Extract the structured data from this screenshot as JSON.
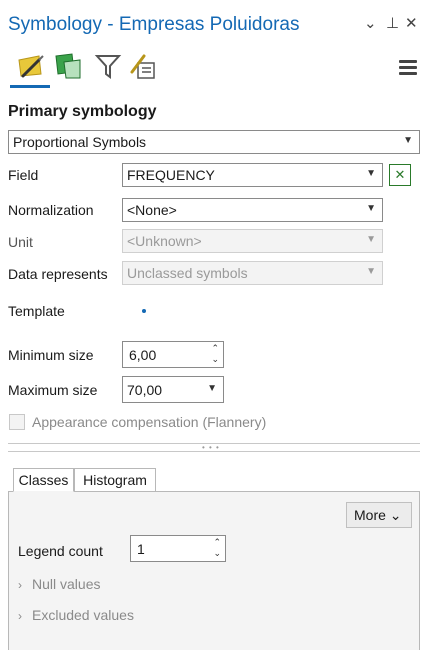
{
  "header": {
    "title": "Symbology - Empresas Poluidoras",
    "controls": [
      "⌄",
      "⊥",
      "✕"
    ]
  },
  "toolbar": {
    "tools": [
      "primary-symbology-icon",
      "vary-symbology-icon",
      "filter-icon",
      "symbol-layer-drawing-icon"
    ],
    "menu_icon": "hamburger-icon"
  },
  "primary": {
    "heading": "Primary symbology",
    "method": "Proportional Symbols"
  },
  "fields": {
    "field_label": "Field",
    "field_value": "FREQUENCY",
    "normalization_label": "Normalization",
    "normalization_value": "<None>",
    "unit_label": "Unit",
    "unit_value": "<Unknown>",
    "data_represents_label": "Data represents",
    "data_represents_value": "Unclassed symbols",
    "template_label": "Template",
    "min_size_label": "Minimum size",
    "min_size_value": "6,00",
    "max_size_label": "Maximum size",
    "max_size_value": "70,00",
    "appearance_label": "Appearance compensation (Flannery)"
  },
  "tabs": [
    {
      "label": "Classes"
    },
    {
      "label": "Histogram"
    }
  ],
  "classes": {
    "more_label": "More ⌄",
    "legend_count_label": "Legend count",
    "legend_count_value": "1",
    "null_values_label": "Null values",
    "excluded_values_label": "Excluded values"
  },
  "colors": {
    "accent": "#1469b4",
    "expression_green": "#2a7a2a"
  }
}
